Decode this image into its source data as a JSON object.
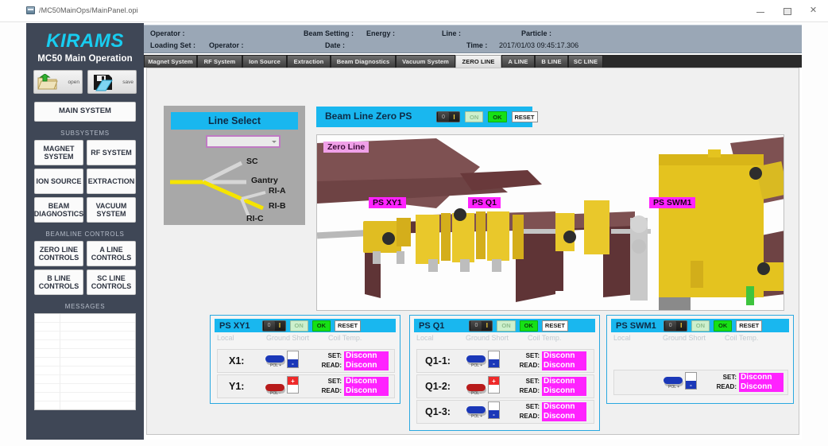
{
  "window": {
    "title": "/MC50MainOps/MainPanel.opi",
    "minimize": "–",
    "maximize": "□",
    "close": "✕"
  },
  "sidebar": {
    "brand": "KIRAMS",
    "brand_sub": "MC50 Main Operation",
    "open_label": "open",
    "save_label": "save",
    "main_system": "MAIN SYSTEM",
    "subsystems_title": "SUBSYSTEMS",
    "subsystems": [
      "MAGNET SYSTEM",
      "RF SYSTEM",
      "ION SOURCE",
      "EXTRACTION",
      "BEAM DIAGNOSTICS",
      "VACUUM SYSTEM"
    ],
    "beamline_title": "BEAMLINE CONTROLS",
    "beamline": [
      "ZERO LINE CONTROLS",
      "A LINE CONTROLS",
      "B LINE CONTROLS",
      "SC LINE CONTROLS"
    ],
    "messages_title": "MESSAGES"
  },
  "infobar": {
    "operator_label": "Operator :",
    "operator_value": "",
    "beam_setting_label": "Beam Setting :",
    "beam_setting_value": "",
    "energy_label": "Energy :",
    "energy_value": "",
    "line_label": "Line :",
    "line_value": "",
    "particle_label": "Particle :",
    "particle_value": "",
    "loading_set_label": "Loading Set :",
    "operator2_label": "Operator :",
    "date_label": "Date :",
    "date_value": "",
    "time_label": "Time :",
    "time_value": "2017/01/03 09:45:17.306"
  },
  "tabs": [
    {
      "label": "Magnet System",
      "active": false
    },
    {
      "label": "RF System",
      "active": false
    },
    {
      "label": "Ion Source",
      "active": false
    },
    {
      "label": "Extraction",
      "active": false
    },
    {
      "label": "Beam Diagnostics",
      "active": false
    },
    {
      "label": "Vacuum System",
      "active": false
    },
    {
      "label": "ZERO LINE",
      "active": true
    },
    {
      "label": "A LINE",
      "active": false
    },
    {
      "label": "B LINE",
      "active": false
    },
    {
      "label": "SC LINE",
      "active": false
    }
  ],
  "line_select": {
    "title": "Line Select",
    "combo_value": "",
    "combo_placeholder": "",
    "branches": [
      "SC",
      "Gantry",
      "RI-A",
      "RI-B",
      "RI-C"
    ],
    "active_branch": "RI-B",
    "active_color": "#f5e400",
    "inactive_color": "#d6d6d6"
  },
  "zero_ps": {
    "title": "Beam Line Zero PS",
    "toggle_off": "0",
    "toggle_on": "I",
    "on_label": "ON",
    "ok_label": "OK",
    "reset_label": "RESET"
  },
  "photo": {
    "zero_line_tag": "Zero Line",
    "tags": [
      "PS XY1",
      "PS Q1",
      "PS SWM1"
    ]
  },
  "status_row": {
    "local": "Local",
    "ground_short": "Ground Short",
    "coil_temp": "Coil Temp."
  },
  "set_label": "SET:",
  "read_label": "READ:",
  "disconnected_value": "Disconn",
  "pol_plus": "POL +",
  "pol_minus": "POL -",
  "ps_panels": [
    {
      "title": "PS XY1",
      "toggle_off": "0",
      "toggle_on": "I",
      "on_label": "ON",
      "ok_label": "OK",
      "reset_label": "RESET",
      "channels": [
        {
          "name": "X1:",
          "polarity": "plus",
          "set": "Disconn",
          "read": "Disconn"
        },
        {
          "name": "Y1:",
          "polarity": "minus",
          "set": "Disconn",
          "read": "Disconn"
        }
      ]
    },
    {
      "title": "PS Q1",
      "toggle_off": "0",
      "toggle_on": "I",
      "on_label": "ON",
      "ok_label": "OK",
      "reset_label": "RESET",
      "channels": [
        {
          "name": "Q1-1:",
          "polarity": "plus",
          "set": "Disconn",
          "read": "Disconn"
        },
        {
          "name": "Q1-2:",
          "polarity": "minus",
          "set": "Disconn",
          "read": "Disconn"
        },
        {
          "name": "Q1-3:",
          "polarity": "plus",
          "set": "Disconn",
          "read": "Disconn"
        }
      ]
    },
    {
      "title": "PS SWM1",
      "toggle_off": "0",
      "toggle_on": "I",
      "on_label": "ON",
      "ok_label": "OK",
      "reset_label": "RESET",
      "channels": [
        {
          "name": "",
          "polarity": "plus",
          "set": "Disconn",
          "read": "Disconn"
        }
      ]
    }
  ],
  "colors": {
    "brand_cyan": "#18cdf0",
    "panel_blue": "#19b7ef",
    "sidebar_bg": "#3f4756",
    "magenta": "#ff22ff",
    "ok_green": "#16e016"
  }
}
